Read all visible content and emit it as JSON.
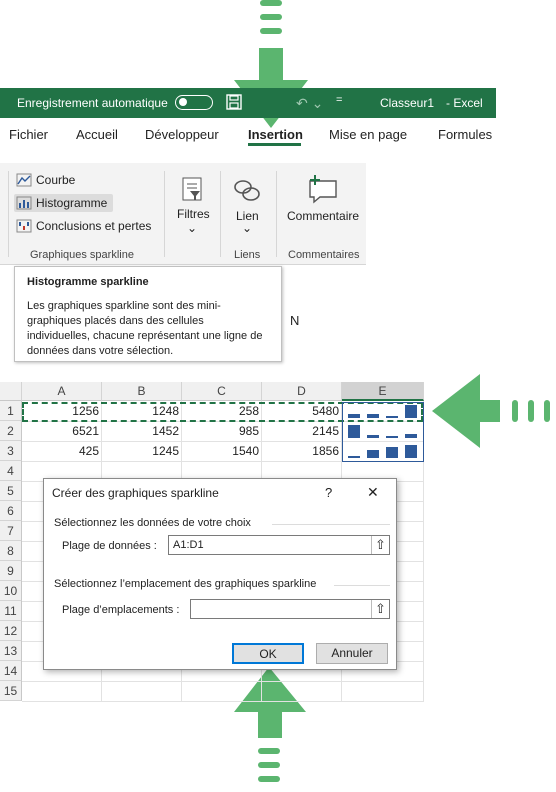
{
  "titlebar": {
    "autosave_label": "Enregistrement automatique",
    "doc_title": "Classeur1",
    "app_title": "-  Excel",
    "more_glyph": "=",
    "color": "#217346"
  },
  "menu": {
    "tabs": [
      "Fichier",
      "Accueil",
      "Développeur",
      "Insertion",
      "Mise en page",
      "Formules"
    ]
  },
  "ribbon": {
    "sparklines": {
      "line": "Courbe",
      "column": "Histogramme",
      "winloss": "Conclusions et pertes",
      "group_label": "Graphiques sparkline"
    },
    "filters": {
      "label": "Filtres",
      "chevron": "⌄"
    },
    "link": {
      "label": "Lien",
      "chevron": "⌄",
      "group_label": "Liens"
    },
    "comment": {
      "label": "Commentaire",
      "group_label": "Commentaires"
    }
  },
  "tooltip": {
    "title": "Histogramme sparkline",
    "body": "Les graphiques sparkline sont des mini-graphiques placés dans des cellules individuelles, chacune représentant une ligne de données dans votre sélection."
  },
  "sheet": {
    "hidden_column": "N",
    "columns": [
      "A",
      "B",
      "C",
      "D",
      "E"
    ],
    "row_numbers": [
      "1",
      "2",
      "3",
      "4",
      "5",
      "6",
      "7",
      "8",
      "9",
      "10",
      "11",
      "12",
      "13",
      "14",
      "15"
    ],
    "rows": [
      [
        "1256",
        "1248",
        "258",
        "5480"
      ],
      [
        "6521",
        "1452",
        "985",
        "2145"
      ],
      [
        "425",
        "1245",
        "1540",
        "1856"
      ]
    ]
  },
  "sparkline_data": {
    "type": "bar",
    "series": [
      [
        1256,
        1248,
        258,
        5480
      ],
      [
        6521,
        1452,
        985,
        2145
      ],
      [
        425,
        1245,
        1540,
        1856
      ]
    ],
    "color": "#2e5a9a"
  },
  "dialog": {
    "title": "Créer des graphiques sparkline",
    "help": "?",
    "close": "✕",
    "section1": "Sélectionnez les données de votre choix",
    "data_range_label": "Plage de données :",
    "data_range_value": "A1:D1",
    "section2": "Sélectionnez l’emplacement des graphiques sparkline",
    "location_label": "Plage d’emplacements :",
    "location_value": "",
    "picker_glyph": "⇧",
    "ok": "OK",
    "cancel": "Annuler"
  },
  "arrow_color": "#5bb56f"
}
